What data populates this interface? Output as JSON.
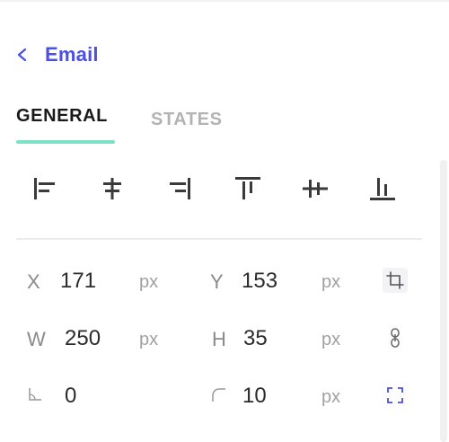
{
  "header": {
    "title": "Email"
  },
  "tabs": [
    {
      "label": "GENERAL",
      "active": true
    },
    {
      "label": "STATES",
      "active": false
    }
  ],
  "align_icons": [
    "align-left-icon",
    "align-horizontal-center-icon",
    "align-right-icon",
    "align-top-icon",
    "align-vertical-center-icon",
    "align-bottom-icon"
  ],
  "properties": {
    "x": {
      "label": "X",
      "value": "171",
      "unit": "px"
    },
    "y": {
      "label": "Y",
      "value": "153",
      "unit": "px"
    },
    "w": {
      "label": "W",
      "value": "250",
      "unit": "px"
    },
    "h": {
      "label": "H",
      "value": "35",
      "unit": "px"
    },
    "rotation": {
      "value": "0"
    },
    "radius": {
      "value": "10",
      "unit": "px"
    }
  },
  "colors": {
    "accent": "#4b4fe6",
    "tab_underline": "#7ee0c4",
    "icon_dark": "#3a3a3a",
    "muted_text": "#8a8a8a"
  }
}
